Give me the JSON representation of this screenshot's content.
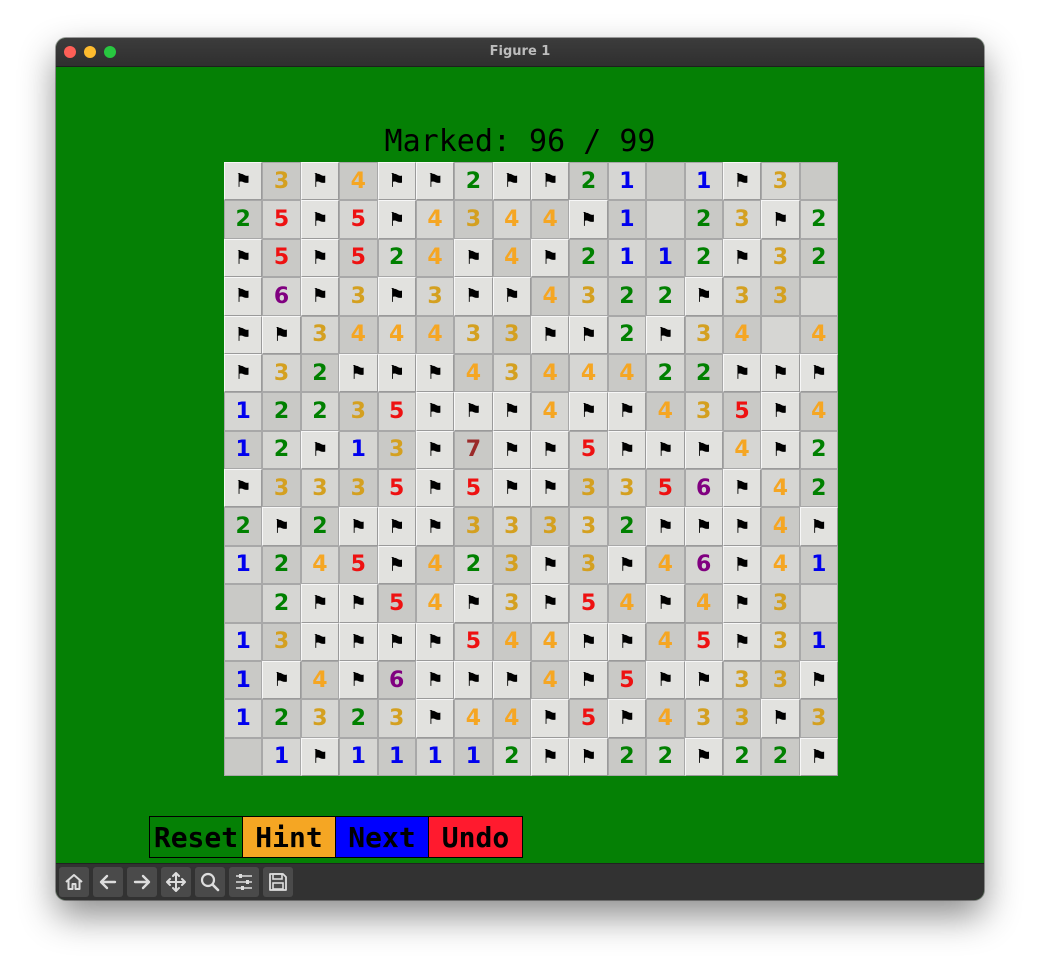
{
  "window": {
    "title": "Figure 1"
  },
  "status": {
    "marked_text": "Marked: 96 / 99"
  },
  "board": {
    "flag_glyph": "⚑",
    "number_colors": {
      "1": "#0000ee",
      "2": "#008000",
      "3": "#d4a020",
      "4": "#f5a623",
      "5": "#ee1111",
      "6": "#800080",
      "7": "#9b2a2a"
    },
    "rows": [
      [
        "F",
        "3",
        "F",
        "4",
        "F",
        "F",
        "2",
        "F",
        "F",
        "2",
        "1",
        "",
        "1",
        "F",
        "3",
        ""
      ],
      [
        "2",
        "5",
        "F",
        "5",
        "F",
        "4",
        "3",
        "4",
        "4",
        "F",
        "1",
        "",
        "2",
        "3",
        "F",
        "2"
      ],
      [
        "F",
        "5",
        "F",
        "5",
        "2",
        "4",
        "F",
        "4",
        "F",
        "2",
        "1",
        "1",
        "2",
        "F",
        "3",
        "2"
      ],
      [
        "F",
        "6",
        "F",
        "3",
        "F",
        "3",
        "F",
        "F",
        "4",
        "3",
        "2",
        "2",
        "F",
        "3",
        "3",
        ""
      ],
      [
        "F",
        "F",
        "3",
        "4",
        "4",
        "4",
        "3",
        "3",
        "F",
        "F",
        "2",
        "F",
        "3",
        "4",
        "",
        "4"
      ],
      [
        "F",
        "3",
        "2",
        "F",
        "F",
        "F",
        "4",
        "3",
        "4",
        "4",
        "4",
        "2",
        "2",
        "F",
        "F",
        "F"
      ],
      [
        "1",
        "2",
        "2",
        "3",
        "5",
        "F",
        "F",
        "F",
        "4",
        "F",
        "F",
        "4",
        "3",
        "5",
        "F",
        "4"
      ],
      [
        "1",
        "2",
        "F",
        "1",
        "3",
        "F",
        "7",
        "F",
        "F",
        "5",
        "F",
        "F",
        "F",
        "4",
        "F",
        "2"
      ],
      [
        "F",
        "3",
        "3",
        "3",
        "5",
        "F",
        "5",
        "F",
        "F",
        "3",
        "3",
        "5",
        "6",
        "F",
        "4",
        "2"
      ],
      [
        "2",
        "F",
        "2",
        "F",
        "F",
        "F",
        "3",
        "3",
        "3",
        "3",
        "2",
        "F",
        "F",
        "F",
        "4",
        "F"
      ],
      [
        "1",
        "2",
        "4",
        "5",
        "F",
        "4",
        "2",
        "3",
        "F",
        "3",
        "F",
        "4",
        "6",
        "F",
        "4",
        "1"
      ],
      [
        "",
        "2",
        "F",
        "F",
        "5",
        "4",
        "F",
        "3",
        "F",
        "5",
        "4",
        "F",
        "4",
        "F",
        "3",
        ""
      ],
      [
        "1",
        "3",
        "F",
        "F",
        "F",
        "F",
        "5",
        "4",
        "4",
        "F",
        "F",
        "4",
        "5",
        "F",
        "3",
        "1"
      ],
      [
        "1",
        "F",
        "4",
        "F",
        "6",
        "F",
        "F",
        "F",
        "4",
        "F",
        "5",
        "F",
        "F",
        "3",
        "3",
        "F"
      ],
      [
        "1",
        "2",
        "3",
        "2",
        "3",
        "F",
        "4",
        "4",
        "F",
        "5",
        "F",
        "4",
        "3",
        "3",
        "F",
        "3"
      ],
      [
        "",
        "1",
        "F",
        "1",
        "1",
        "1",
        "1",
        "2",
        "F",
        "F",
        "2",
        "2",
        "F",
        "2",
        "2",
        "F"
      ]
    ]
  },
  "buttons": [
    {
      "label": "Reset",
      "color": "#058005",
      "name": "reset-button"
    },
    {
      "label": "Hint",
      "color": "#f5a623",
      "name": "hint-button"
    },
    {
      "label": "Next",
      "color": "#0000ff",
      "name": "next-button"
    },
    {
      "label": "Undo",
      "color": "#ff1a2e",
      "name": "undo-button"
    }
  ],
  "toolbar": {
    "icons": [
      "home-icon",
      "back-arrow-icon",
      "forward-arrow-icon",
      "pan-icon",
      "zoom-icon",
      "configure-icon",
      "save-icon"
    ]
  }
}
